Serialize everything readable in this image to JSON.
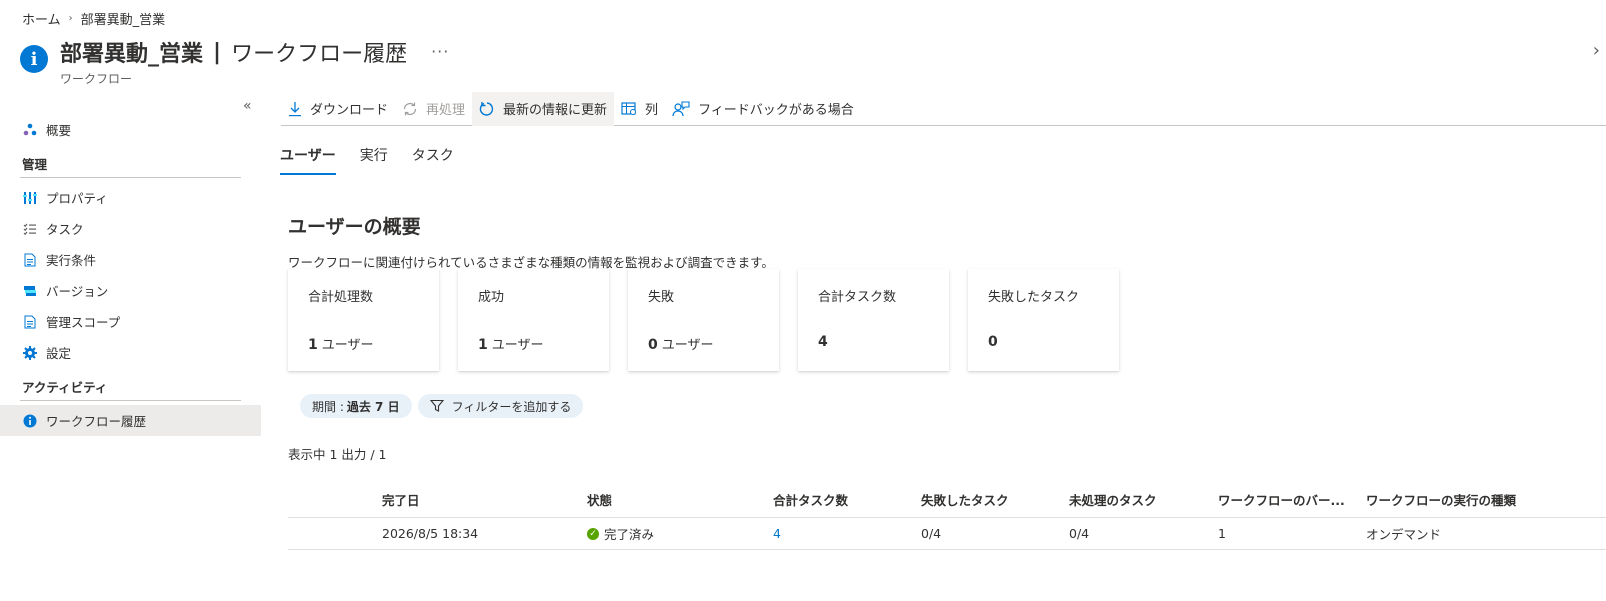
{
  "breadcrumb": {
    "home": "ホーム",
    "current": "部署異動_営業"
  },
  "header": {
    "title_bold": "部署異動_営業",
    "separator": "|",
    "title_rest": "ワークフロー履歴",
    "subtitle": "ワークフロー",
    "more": "···"
  },
  "sidebar": {
    "collapse": "«",
    "overview": "概要",
    "section_manage": "管理",
    "items_manage": [
      {
        "label": "プロパティ",
        "icon": "properties-icon"
      },
      {
        "label": "タスク",
        "icon": "task-list-icon"
      },
      {
        "label": "実行条件",
        "icon": "document-icon"
      },
      {
        "label": "バージョン",
        "icon": "versions-icon"
      },
      {
        "label": "管理スコープ",
        "icon": "document-icon"
      },
      {
        "label": "設定",
        "icon": "gear-icon"
      }
    ],
    "section_activity": "アクティビティ",
    "active_item": "ワークフロー履歴"
  },
  "toolbar": {
    "download": "ダウンロード",
    "reprocess": "再処理",
    "refresh": "最新の情報に更新",
    "columns": "列",
    "feedback": "フィードバックがある場合"
  },
  "tabs": [
    "ユーザー",
    "実行",
    "タスク"
  ],
  "summary": {
    "title": "ユーザーの概要",
    "description": "ワークフローに関連付けられているさまざまな種類の情報を監視および調査できます。"
  },
  "cards": [
    {
      "label": "合計処理数",
      "value": "1",
      "unit": "ユーザー"
    },
    {
      "label": "成功",
      "value": "1",
      "unit": "ユーザー"
    },
    {
      "label": "失敗",
      "value": "0",
      "unit": "ユーザー"
    },
    {
      "label": "合計タスク数",
      "value": "4",
      "unit": ""
    },
    {
      "label": "失敗したタスク",
      "value": "0",
      "unit": ""
    }
  ],
  "filters": {
    "period_label": "期間 :",
    "period_value": "過去 7 日",
    "add_filter": "フィルターを追加する"
  },
  "showing": "表示中 1 出力 / 1",
  "table": {
    "columns": [
      "完了日",
      "状態",
      "合計タスク数",
      "失敗したタスク",
      "未処理のタスク",
      "ワークフローのバー...",
      "ワークフローの実行の種類"
    ],
    "rows": [
      [
        "2026/8/5 18:34",
        "完了済み",
        "4",
        "0/4",
        "0/4",
        "1",
        "オンデマンド"
      ]
    ]
  },
  "colors": {
    "accent": "#0078d4",
    "success": "#57a300"
  }
}
